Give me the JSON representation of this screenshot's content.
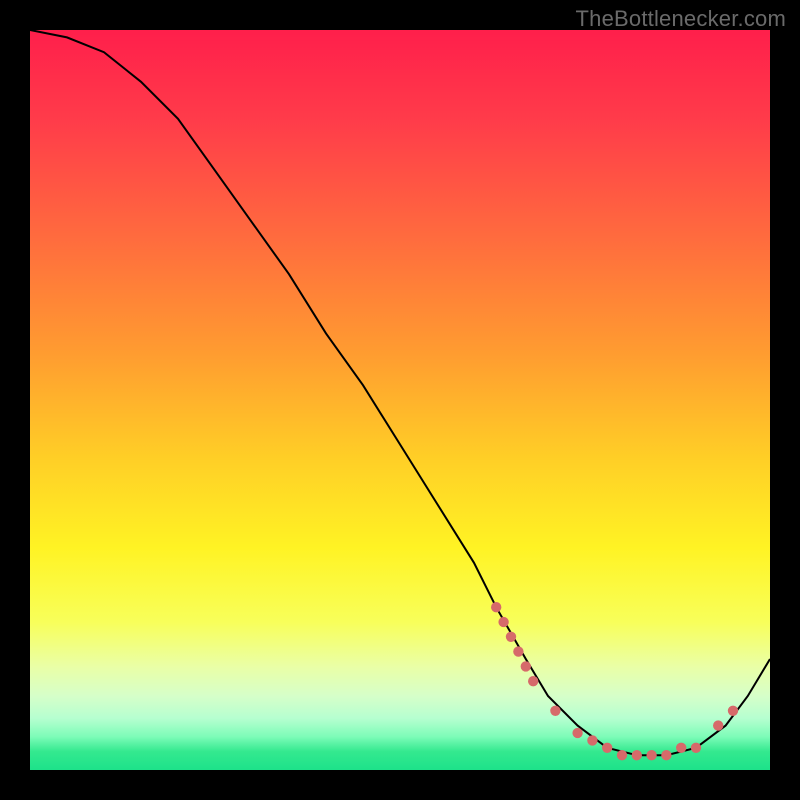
{
  "watermark": "TheBottlenecker.com",
  "colors": {
    "bg": "#000000",
    "curve": "#000000",
    "marker": "#d66a6a",
    "gradient_stops": [
      {
        "offset": 0.0,
        "color": "#ff1f4b"
      },
      {
        "offset": 0.12,
        "color": "#ff3b4a"
      },
      {
        "offset": 0.28,
        "color": "#ff6b3e"
      },
      {
        "offset": 0.44,
        "color": "#ff9d30"
      },
      {
        "offset": 0.58,
        "color": "#ffcf26"
      },
      {
        "offset": 0.7,
        "color": "#fff324"
      },
      {
        "offset": 0.8,
        "color": "#f8ff5a"
      },
      {
        "offset": 0.86,
        "color": "#eaffa6"
      },
      {
        "offset": 0.9,
        "color": "#d6ffc9"
      },
      {
        "offset": 0.93,
        "color": "#b6ffd0"
      },
      {
        "offset": 0.955,
        "color": "#7dfcb8"
      },
      {
        "offset": 0.975,
        "color": "#34e98f"
      },
      {
        "offset": 1.0,
        "color": "#1de28a"
      }
    ]
  },
  "chart_data": {
    "type": "line",
    "title": "",
    "xlabel": "",
    "ylabel": "",
    "xlim": [
      0,
      100
    ],
    "ylim": [
      0,
      100
    ],
    "series": [
      {
        "name": "bottleneck-curve",
        "x": [
          0,
          5,
          10,
          15,
          20,
          25,
          30,
          35,
          40,
          45,
          50,
          55,
          60,
          63,
          67,
          70,
          74,
          78,
          82,
          86,
          90,
          94,
          97,
          100
        ],
        "y": [
          100,
          99,
          97,
          93,
          88,
          81,
          74,
          67,
          59,
          52,
          44,
          36,
          28,
          22,
          15,
          10,
          6,
          3,
          2,
          2,
          3,
          6,
          10,
          15
        ]
      }
    ],
    "markers": {
      "name": "highlight-dots",
      "x": [
        63,
        64,
        65,
        66,
        67,
        68,
        71,
        74,
        76,
        78,
        80,
        82,
        84,
        86,
        88,
        90,
        93,
        95
      ],
      "y": [
        22,
        20,
        18,
        16,
        14,
        12,
        8,
        5,
        4,
        3,
        2,
        2,
        2,
        2,
        3,
        3,
        6,
        8
      ]
    }
  }
}
